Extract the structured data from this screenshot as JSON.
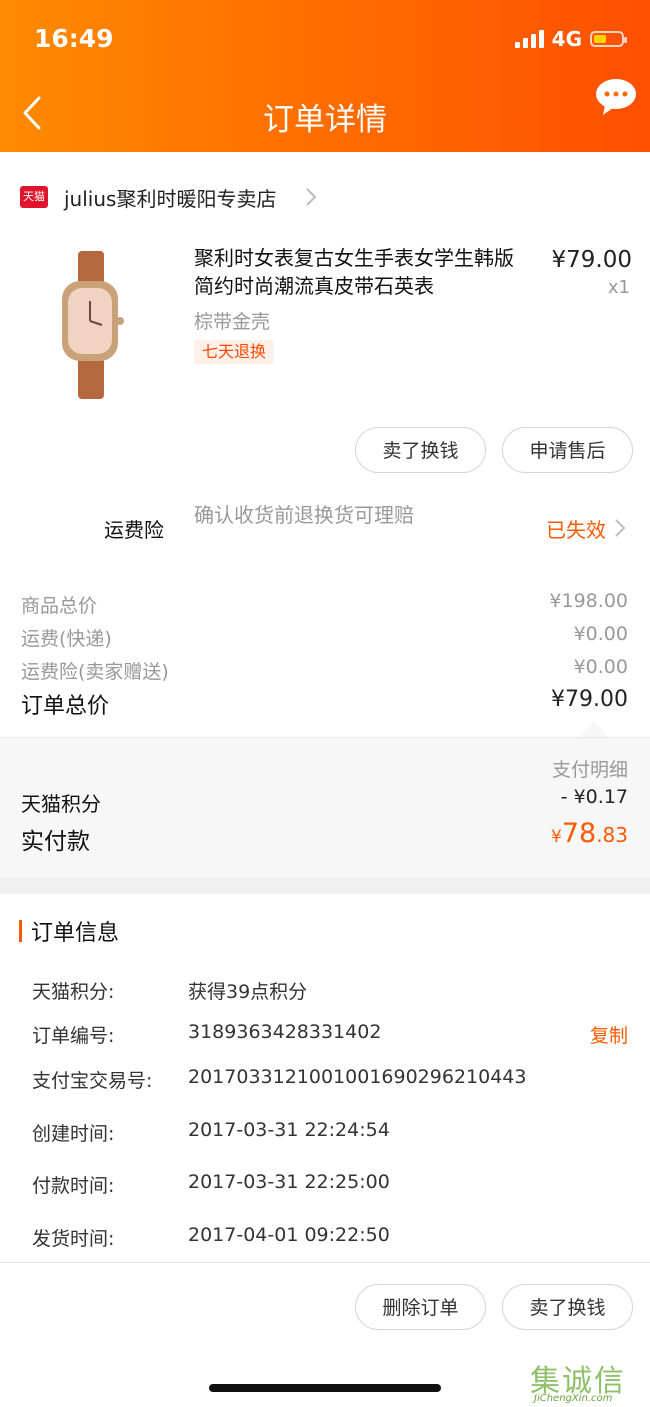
{
  "status_bar": {
    "time": "16:49",
    "network": "4G"
  },
  "nav": {
    "title": "订单详情"
  },
  "shop": {
    "badge": "天猫",
    "name": "julius聚利时暖阳专卖店"
  },
  "product": {
    "title": "聚利时女表复古女生手表女学生韩版简约时尚潮流真皮带石英表",
    "price": "¥79.00",
    "quantity": "x1",
    "sku": "棕带金壳",
    "tag": "七天退换"
  },
  "item_actions": {
    "sell_label": "卖了换钱",
    "aftersale_label": "申请售后"
  },
  "insurance": {
    "label": "运费险",
    "description": "确认收货前退换货可理赔",
    "status": "已失效"
  },
  "fees": [
    {
      "label": "商品总价",
      "value": "¥198.00"
    },
    {
      "label": "运费(快递)",
      "value": "¥0.00"
    },
    {
      "label": "运费险(卖家赠送)",
      "value": "¥0.00"
    }
  ],
  "total": {
    "label": "订单总价",
    "value": "¥79.00"
  },
  "payment": {
    "detail_label": "支付明细",
    "points_label": "天猫积分",
    "points_value": "- ¥0.17",
    "paid_label": "实付款",
    "paid_currency": "¥",
    "paid_int": "78",
    "paid_dec": ".83"
  },
  "order_info": {
    "title": "订单信息",
    "rows": [
      {
        "label": "天猫积分:",
        "value": "获得39点积分"
      },
      {
        "label": "订单编号:",
        "value": "3189363428331402"
      },
      {
        "label": "支付宝交易号:",
        "value": "2017033121001001690296210443"
      },
      {
        "label": "创建时间:",
        "value": "2017-03-31 22:24:54"
      },
      {
        "label": "付款时间:",
        "value": "2017-03-31 22:25:00"
      },
      {
        "label": "发货时间:",
        "value": "2017-04-01 09:22:50"
      }
    ],
    "copy_label": "复制"
  },
  "footer_actions": {
    "delete_label": "删除订单",
    "sell_label": "卖了换钱"
  },
  "watermark": {
    "text": "集诚信",
    "url": "JiChengXin.com"
  },
  "colors": {
    "accent": "#ff5a00",
    "header_start": "#ff8a00",
    "header_end": "#ff4f00",
    "tmall_red": "#e0142b"
  }
}
